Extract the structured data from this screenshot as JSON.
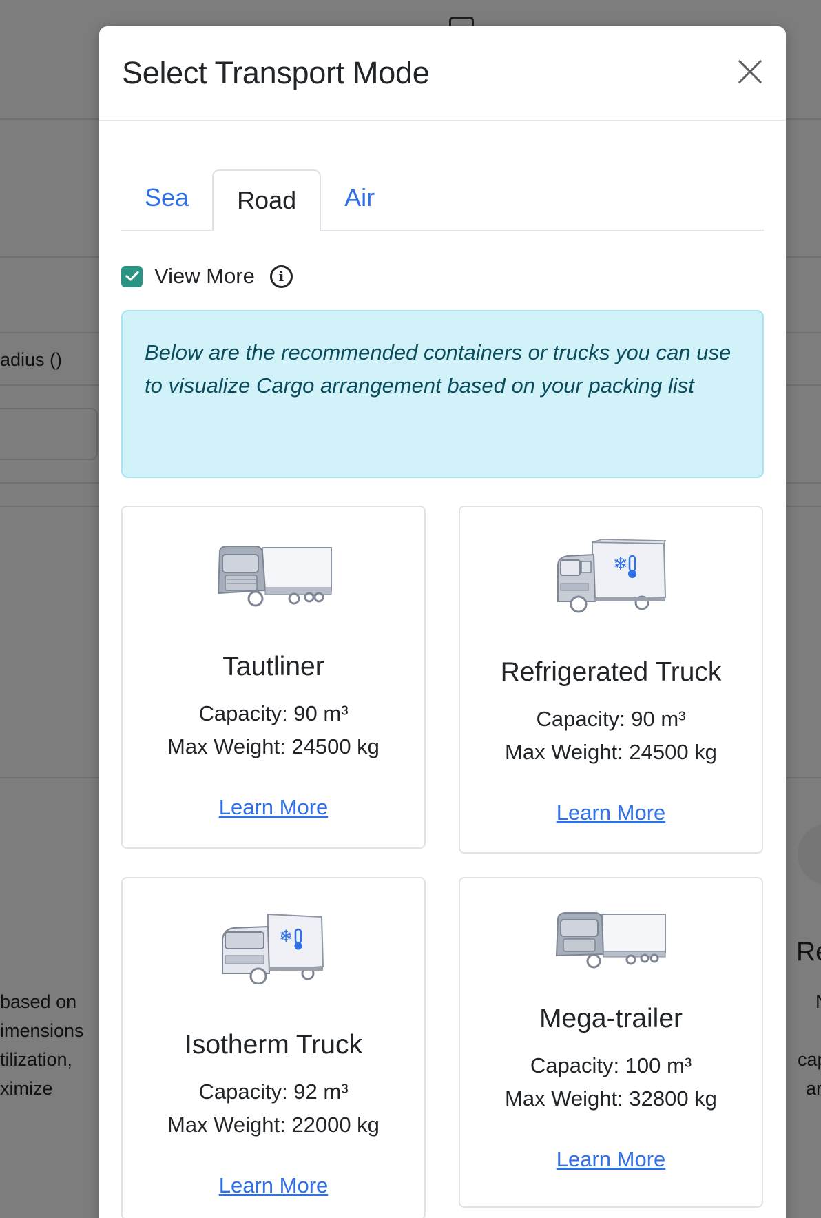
{
  "background": {
    "label_radius": "adius ()",
    "para_left": [
      "based on",
      "imensions",
      "tilization,",
      "ximize"
    ],
    "para_right_heading": "Re",
    "para_right": [
      "N",
      "cap",
      "ar"
    ]
  },
  "modal": {
    "title": "Select Transport Mode",
    "tabs": [
      {
        "label": "Sea"
      },
      {
        "label": "Road"
      },
      {
        "label": "Air"
      }
    ],
    "active_tab": "Road",
    "view_more_label": "View More",
    "view_more_checked": true,
    "info": "Below are the recommended containers or trucks you can use to visualize Cargo arrangement based on your packing list",
    "cards": [
      {
        "title": "Tautliner",
        "capacity": "Capacity: 90 m³",
        "max_weight": "Max Weight: 24500 kg",
        "link": "Learn More",
        "icon": "tautliner-truck-icon"
      },
      {
        "title": "Refrigerated Truck",
        "capacity": "Capacity: 90 m³",
        "max_weight": "Max Weight: 24500 kg",
        "link": "Learn More",
        "icon": "refrigerated-truck-icon"
      },
      {
        "title": "Isotherm Truck",
        "capacity": "Capacity: 92 m³",
        "max_weight": "Max Weight: 22000 kg",
        "link": "Learn More",
        "icon": "isotherm-truck-icon"
      },
      {
        "title": "Mega-trailer",
        "capacity": "Capacity: 100 m³",
        "max_weight": "Max Weight: 32800 kg",
        "link": "Learn More",
        "icon": "mega-trailer-truck-icon"
      }
    ]
  },
  "colors": {
    "accent": "#2f6fe8",
    "checkbox": "#2a9383",
    "alert_bg": "#d1f2f9",
    "overlay": "#7d7d7d"
  }
}
